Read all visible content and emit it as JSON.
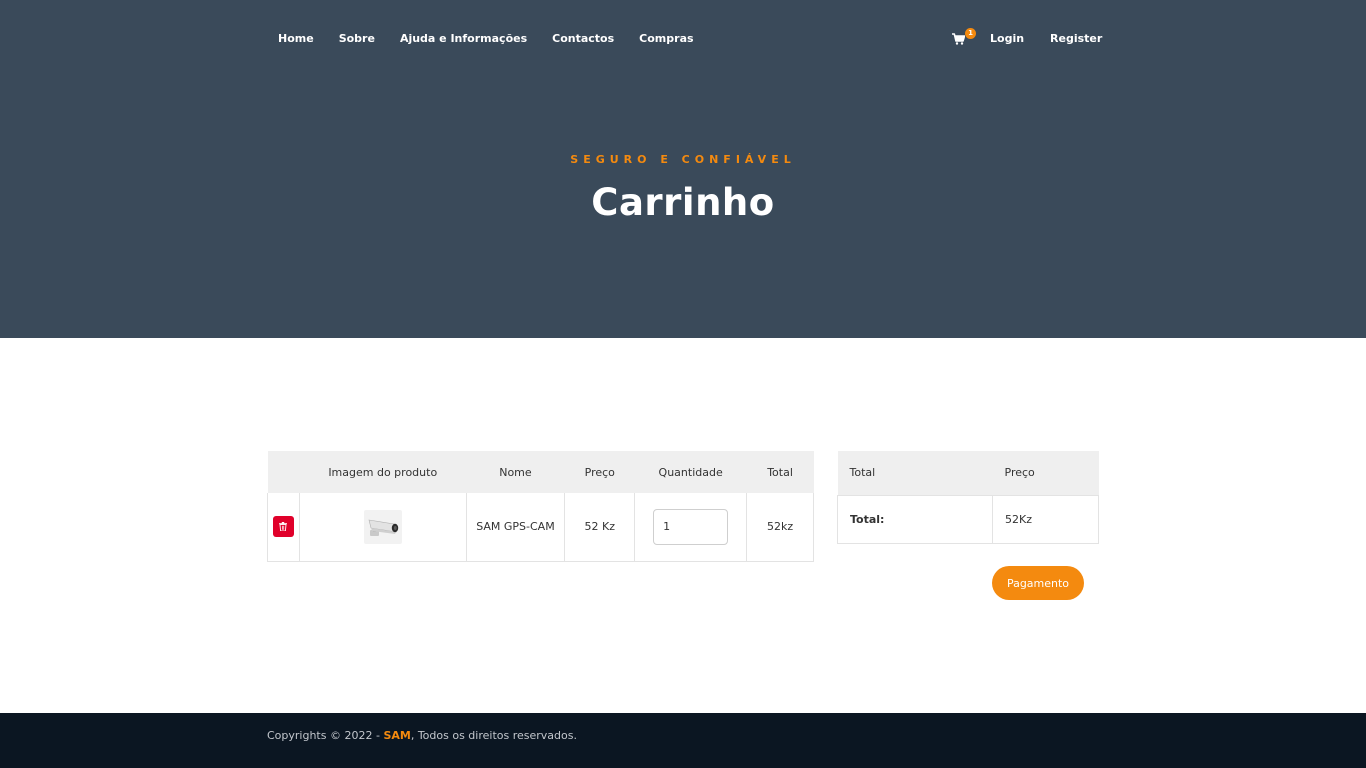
{
  "nav": {
    "links": [
      "Home",
      "Sobre",
      "Ajuda e Informações",
      "Contactos",
      "Compras"
    ],
    "cart_count": "1",
    "login": "Login",
    "register": "Register"
  },
  "hero": {
    "tagline": "SEGURO E CONFIÁVEL",
    "title": "Carrinho"
  },
  "cart": {
    "headers": [
      "",
      "Imagem do produto",
      "Nome",
      "Preço",
      "Quantidade",
      "Total"
    ],
    "items": [
      {
        "name": "SAM GPS-CAM",
        "price": "52 Kz",
        "quantity": "1",
        "total": "52kz"
      }
    ]
  },
  "summary": {
    "headers": [
      "Total",
      "Preço"
    ],
    "total_label": "Total:",
    "total_value": "52Kz"
  },
  "pay_button": "Pagamento",
  "footer": {
    "prefix": "Copyrights © 2022 - ",
    "brand": "SAM",
    "suffix": ", Todos os direitos reservados."
  },
  "colors": {
    "hero_bg": "#3a4a5a",
    "accent": "#f48a0f",
    "delete": "#e0002a",
    "footer_bg": "#0b1622"
  },
  "icons": [
    "cart-icon",
    "trash-icon",
    "camera-product-image"
  ]
}
